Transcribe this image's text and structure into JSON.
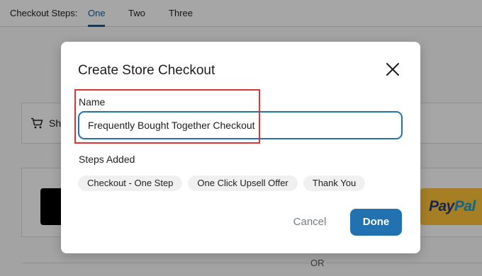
{
  "background": {
    "steps_label": "Checkout Steps:",
    "step_tabs": [
      "One",
      "Two",
      "Three"
    ],
    "active_step": "One",
    "shipping_text": "Sh",
    "paypal_text_1": "Pay",
    "paypal_text_2": "Pal",
    "or_text": "OR"
  },
  "modal": {
    "title": "Create Store Checkout",
    "close_icon": "close-icon",
    "name_label": "Name",
    "name_value": "Frequently Bought Together Checkout",
    "steps_added_label": "Steps Added",
    "steps": [
      "Checkout - One Step",
      "One Click Upsell Offer",
      "Thank You"
    ],
    "cancel_label": "Cancel",
    "done_label": "Done"
  },
  "colors": {
    "accent": "#2271b1",
    "highlight": "#d63638",
    "paypal_yellow": "#ffc439"
  }
}
